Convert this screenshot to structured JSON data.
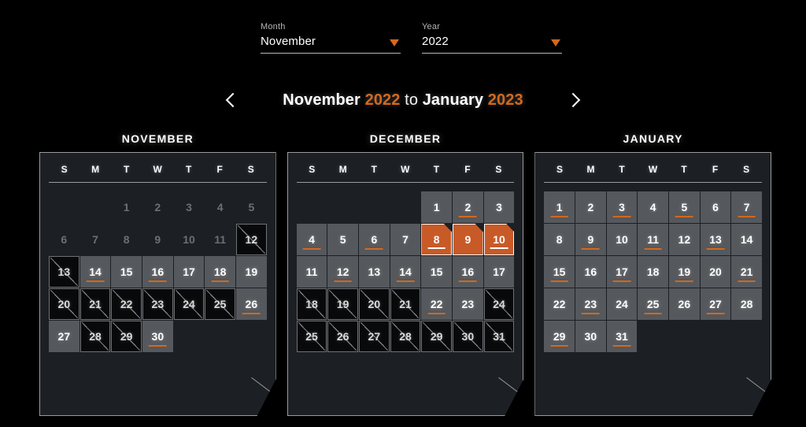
{
  "selectors": {
    "month": {
      "label": "Month",
      "value": "November",
      "caret": "chevron-down-icon"
    },
    "year": {
      "label": "Year",
      "value": "2022",
      "caret": "chevron-down-icon"
    }
  },
  "range": {
    "prev_icon": "chevron-left-icon",
    "next_icon": "chevron-right-icon",
    "start_month": "November",
    "start_year": "2022",
    "connector": " to ",
    "end_month": "January",
    "end_year": "2023"
  },
  "colors": {
    "accent": "#d2691e",
    "selected": "#c85a28",
    "available": "#55585c",
    "blocked": "#08090a",
    "panel": "#1c1f24",
    "background": "#000000"
  },
  "weekdays": [
    "S",
    "M",
    "T",
    "W",
    "T",
    "F",
    "S"
  ],
  "months": [
    {
      "name": "NOVEMBER",
      "lead_blanks": 2,
      "days": [
        {
          "n": "1",
          "state": "disabled",
          "marker": false
        },
        {
          "n": "2",
          "state": "disabled",
          "marker": false
        },
        {
          "n": "3",
          "state": "disabled",
          "marker": false
        },
        {
          "n": "4",
          "state": "disabled",
          "marker": false
        },
        {
          "n": "5",
          "state": "disabled",
          "marker": false
        },
        {
          "n": "6",
          "state": "disabled",
          "marker": false
        },
        {
          "n": "7",
          "state": "disabled",
          "marker": false
        },
        {
          "n": "8",
          "state": "disabled",
          "marker": false
        },
        {
          "n": "9",
          "state": "disabled",
          "marker": false
        },
        {
          "n": "10",
          "state": "disabled",
          "marker": false
        },
        {
          "n": "11",
          "state": "disabled",
          "marker": false
        },
        {
          "n": "12",
          "state": "blocked",
          "marker": false
        },
        {
          "n": "13",
          "state": "blocked",
          "marker": false
        },
        {
          "n": "14",
          "state": "available",
          "marker": true
        },
        {
          "n": "15",
          "state": "available",
          "marker": false
        },
        {
          "n": "16",
          "state": "available",
          "marker": true
        },
        {
          "n": "17",
          "state": "available",
          "marker": false
        },
        {
          "n": "18",
          "state": "available",
          "marker": true
        },
        {
          "n": "19",
          "state": "available",
          "marker": false
        },
        {
          "n": "20",
          "state": "blocked",
          "marker": false
        },
        {
          "n": "21",
          "state": "blocked",
          "marker": false
        },
        {
          "n": "22",
          "state": "blocked",
          "marker": false
        },
        {
          "n": "23",
          "state": "blocked",
          "marker": false
        },
        {
          "n": "24",
          "state": "blocked",
          "marker": false
        },
        {
          "n": "25",
          "state": "blocked",
          "marker": false
        },
        {
          "n": "26",
          "state": "available",
          "marker": true
        },
        {
          "n": "27",
          "state": "available",
          "marker": false
        },
        {
          "n": "28",
          "state": "blocked",
          "marker": false
        },
        {
          "n": "29",
          "state": "blocked",
          "marker": false
        },
        {
          "n": "30",
          "state": "available",
          "marker": true
        }
      ]
    },
    {
      "name": "DECEMBER",
      "lead_blanks": 4,
      "days": [
        {
          "n": "1",
          "state": "available",
          "marker": false
        },
        {
          "n": "2",
          "state": "available",
          "marker": true
        },
        {
          "n": "3",
          "state": "available",
          "marker": false
        },
        {
          "n": "4",
          "state": "available",
          "marker": true
        },
        {
          "n": "5",
          "state": "available",
          "marker": false
        },
        {
          "n": "6",
          "state": "available",
          "marker": true
        },
        {
          "n": "7",
          "state": "available",
          "marker": false
        },
        {
          "n": "8",
          "state": "selected",
          "marker": true
        },
        {
          "n": "9",
          "state": "selected",
          "marker": false
        },
        {
          "n": "10",
          "state": "selected",
          "marker": true
        },
        {
          "n": "11",
          "state": "available",
          "marker": false
        },
        {
          "n": "12",
          "state": "available",
          "marker": true
        },
        {
          "n": "13",
          "state": "available",
          "marker": false
        },
        {
          "n": "14",
          "state": "available",
          "marker": true
        },
        {
          "n": "15",
          "state": "available",
          "marker": false
        },
        {
          "n": "16",
          "state": "available",
          "marker": true
        },
        {
          "n": "17",
          "state": "available",
          "marker": false
        },
        {
          "n": "18",
          "state": "blocked",
          "marker": false
        },
        {
          "n": "19",
          "state": "blocked",
          "marker": false
        },
        {
          "n": "20",
          "state": "blocked",
          "marker": false
        },
        {
          "n": "21",
          "state": "blocked",
          "marker": false
        },
        {
          "n": "22",
          "state": "available",
          "marker": true
        },
        {
          "n": "23",
          "state": "available",
          "marker": false
        },
        {
          "n": "24",
          "state": "blocked",
          "marker": false
        },
        {
          "n": "25",
          "state": "blocked",
          "marker": false
        },
        {
          "n": "26",
          "state": "blocked",
          "marker": false
        },
        {
          "n": "27",
          "state": "blocked",
          "marker": false
        },
        {
          "n": "28",
          "state": "blocked",
          "marker": false
        },
        {
          "n": "29",
          "state": "blocked",
          "marker": false
        },
        {
          "n": "30",
          "state": "blocked",
          "marker": false
        },
        {
          "n": "31",
          "state": "blocked",
          "marker": false
        }
      ]
    },
    {
      "name": "JANUARY",
      "lead_blanks": 0,
      "days": [
        {
          "n": "1",
          "state": "available",
          "marker": true
        },
        {
          "n": "2",
          "state": "available",
          "marker": false
        },
        {
          "n": "3",
          "state": "available",
          "marker": true
        },
        {
          "n": "4",
          "state": "available",
          "marker": false
        },
        {
          "n": "5",
          "state": "available",
          "marker": true
        },
        {
          "n": "6",
          "state": "available",
          "marker": false
        },
        {
          "n": "7",
          "state": "available",
          "marker": true
        },
        {
          "n": "8",
          "state": "available",
          "marker": false
        },
        {
          "n": "9",
          "state": "available",
          "marker": true
        },
        {
          "n": "10",
          "state": "available",
          "marker": false
        },
        {
          "n": "11",
          "state": "available",
          "marker": true
        },
        {
          "n": "12",
          "state": "available",
          "marker": false
        },
        {
          "n": "13",
          "state": "available",
          "marker": true
        },
        {
          "n": "14",
          "state": "available",
          "marker": false
        },
        {
          "n": "15",
          "state": "available",
          "marker": true
        },
        {
          "n": "16",
          "state": "available",
          "marker": false
        },
        {
          "n": "17",
          "state": "available",
          "marker": true
        },
        {
          "n": "18",
          "state": "available",
          "marker": false
        },
        {
          "n": "19",
          "state": "available",
          "marker": true
        },
        {
          "n": "20",
          "state": "available",
          "marker": false
        },
        {
          "n": "21",
          "state": "available",
          "marker": true
        },
        {
          "n": "22",
          "state": "available",
          "marker": false
        },
        {
          "n": "23",
          "state": "available",
          "marker": true
        },
        {
          "n": "24",
          "state": "available",
          "marker": false
        },
        {
          "n": "25",
          "state": "available",
          "marker": true
        },
        {
          "n": "26",
          "state": "available",
          "marker": false
        },
        {
          "n": "27",
          "state": "available",
          "marker": true
        },
        {
          "n": "28",
          "state": "available",
          "marker": false
        },
        {
          "n": "29",
          "state": "available",
          "marker": true
        },
        {
          "n": "30",
          "state": "available",
          "marker": false
        },
        {
          "n": "31",
          "state": "available",
          "marker": true
        }
      ]
    }
  ]
}
